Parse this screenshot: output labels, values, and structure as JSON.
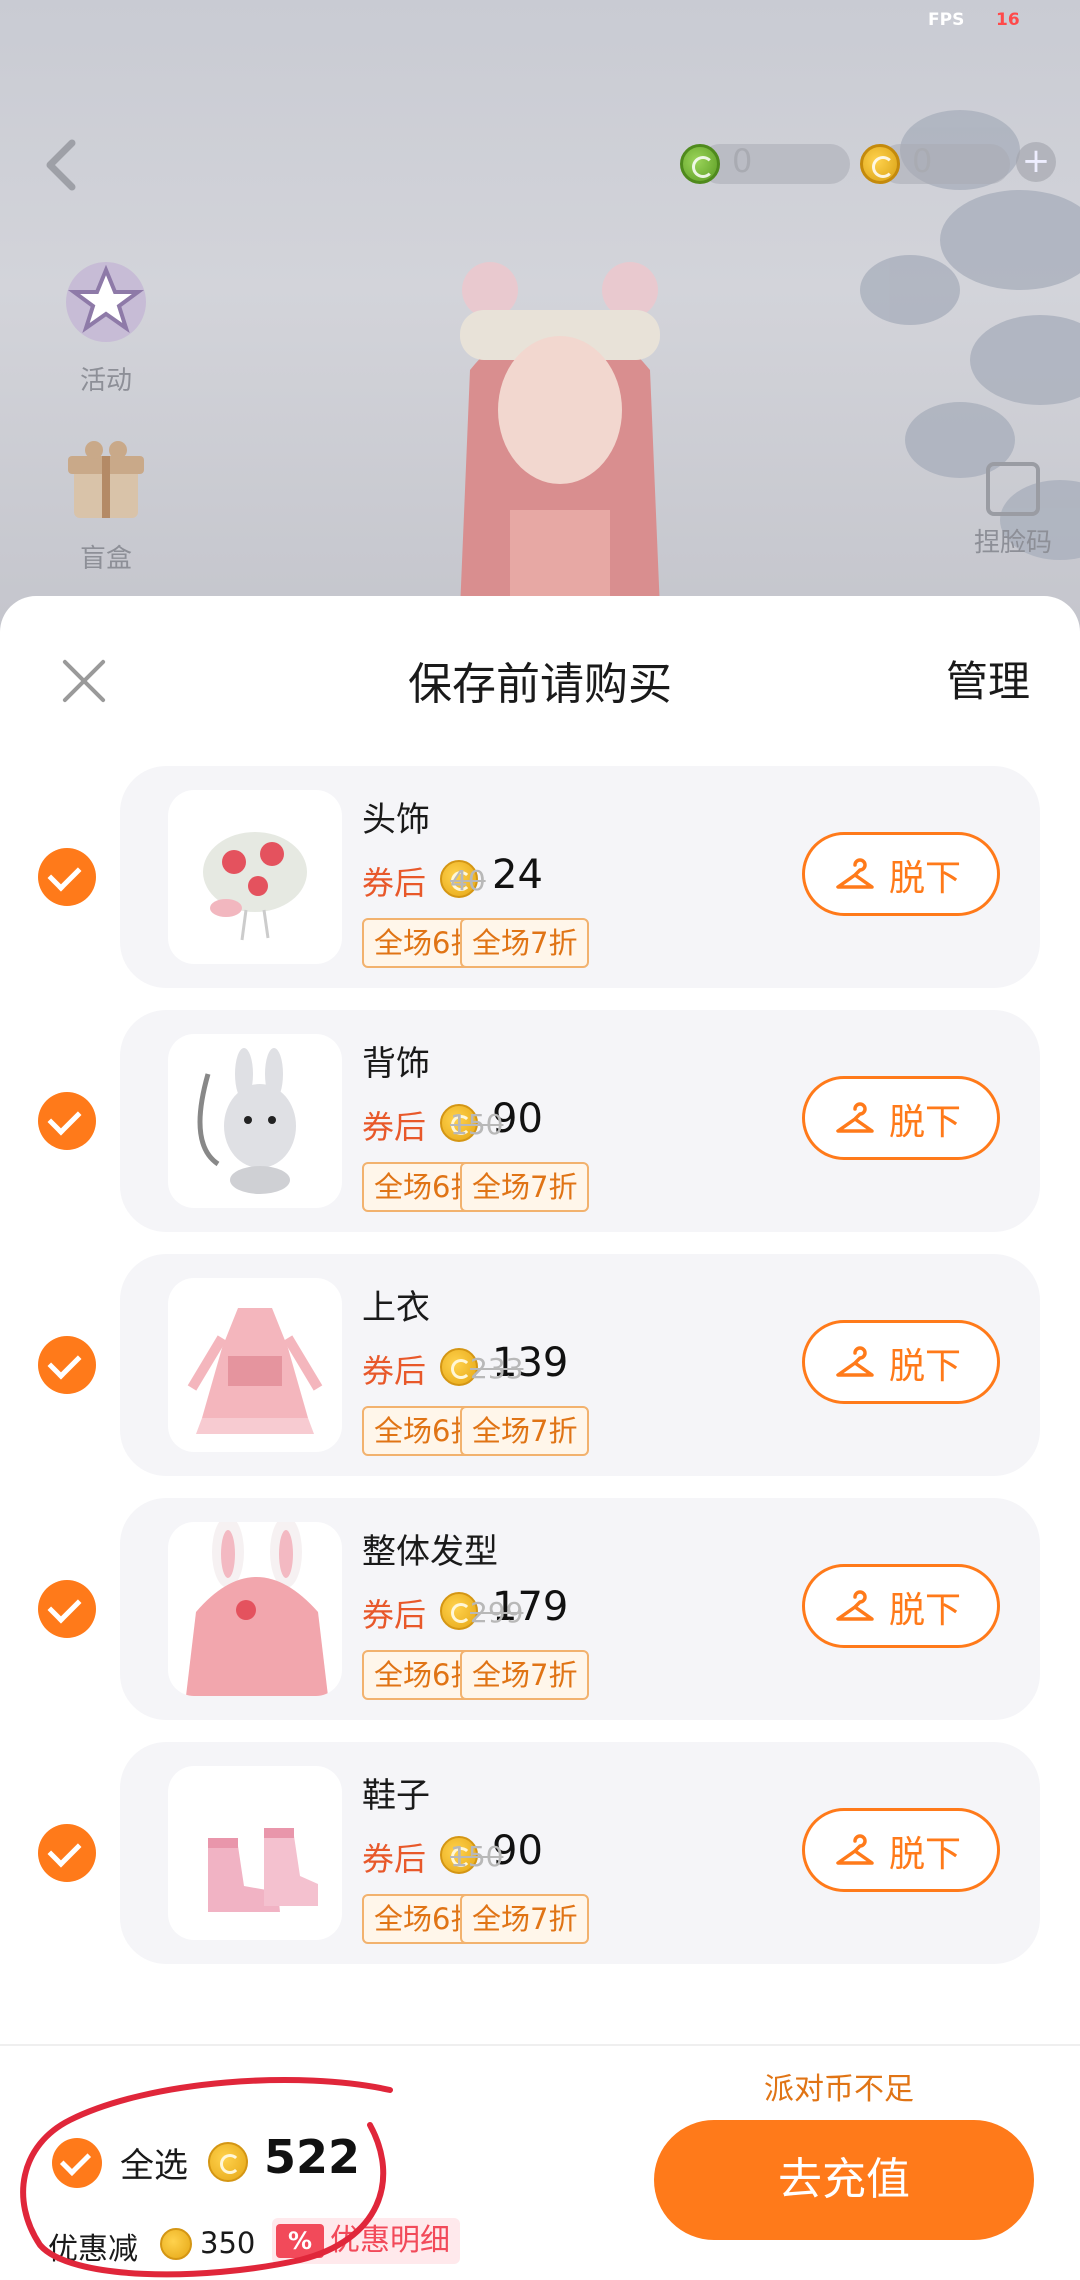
{
  "status": {
    "fps_label": "FPS",
    "fps_value": "16"
  },
  "currency": {
    "green_value": "0",
    "gold_value": "0",
    "add_symbol": "+"
  },
  "side_menu": [
    {
      "label": "活动",
      "icon": "star-badge-icon"
    },
    {
      "label": "盲盒",
      "icon": "gift-box-icon"
    }
  ],
  "face_code": {
    "label": "捏脸码",
    "icon": "face-code-icon"
  },
  "sheet": {
    "title": "保存前请购买",
    "manage_label": "管理",
    "coupon_label": "券后",
    "take_off_label": "脱下",
    "tags": [
      "全场6折",
      "全场7折"
    ],
    "items": [
      {
        "name": "头饰",
        "price": "24",
        "original_price": "40"
      },
      {
        "name": "背饰",
        "price": "90",
        "original_price": "150"
      },
      {
        "name": "上衣",
        "price": "139",
        "original_price": "233"
      },
      {
        "name": "整体发型",
        "price": "179",
        "original_price": "299"
      },
      {
        "name": "鞋子",
        "price": "90",
        "original_price": "150"
      }
    ]
  },
  "footer": {
    "select_all_label": "全选",
    "total": "522",
    "discount_label": "优惠减",
    "discount_value": "350",
    "discount_badge": "%",
    "discount_detail_label": "优惠明细",
    "insufficient_label": "派对币不足",
    "recharge_label": "去充值"
  },
  "colors": {
    "accent": "#ff7a1a",
    "coupon_red": "#e8582a",
    "annotation_red": "#e0263a"
  }
}
